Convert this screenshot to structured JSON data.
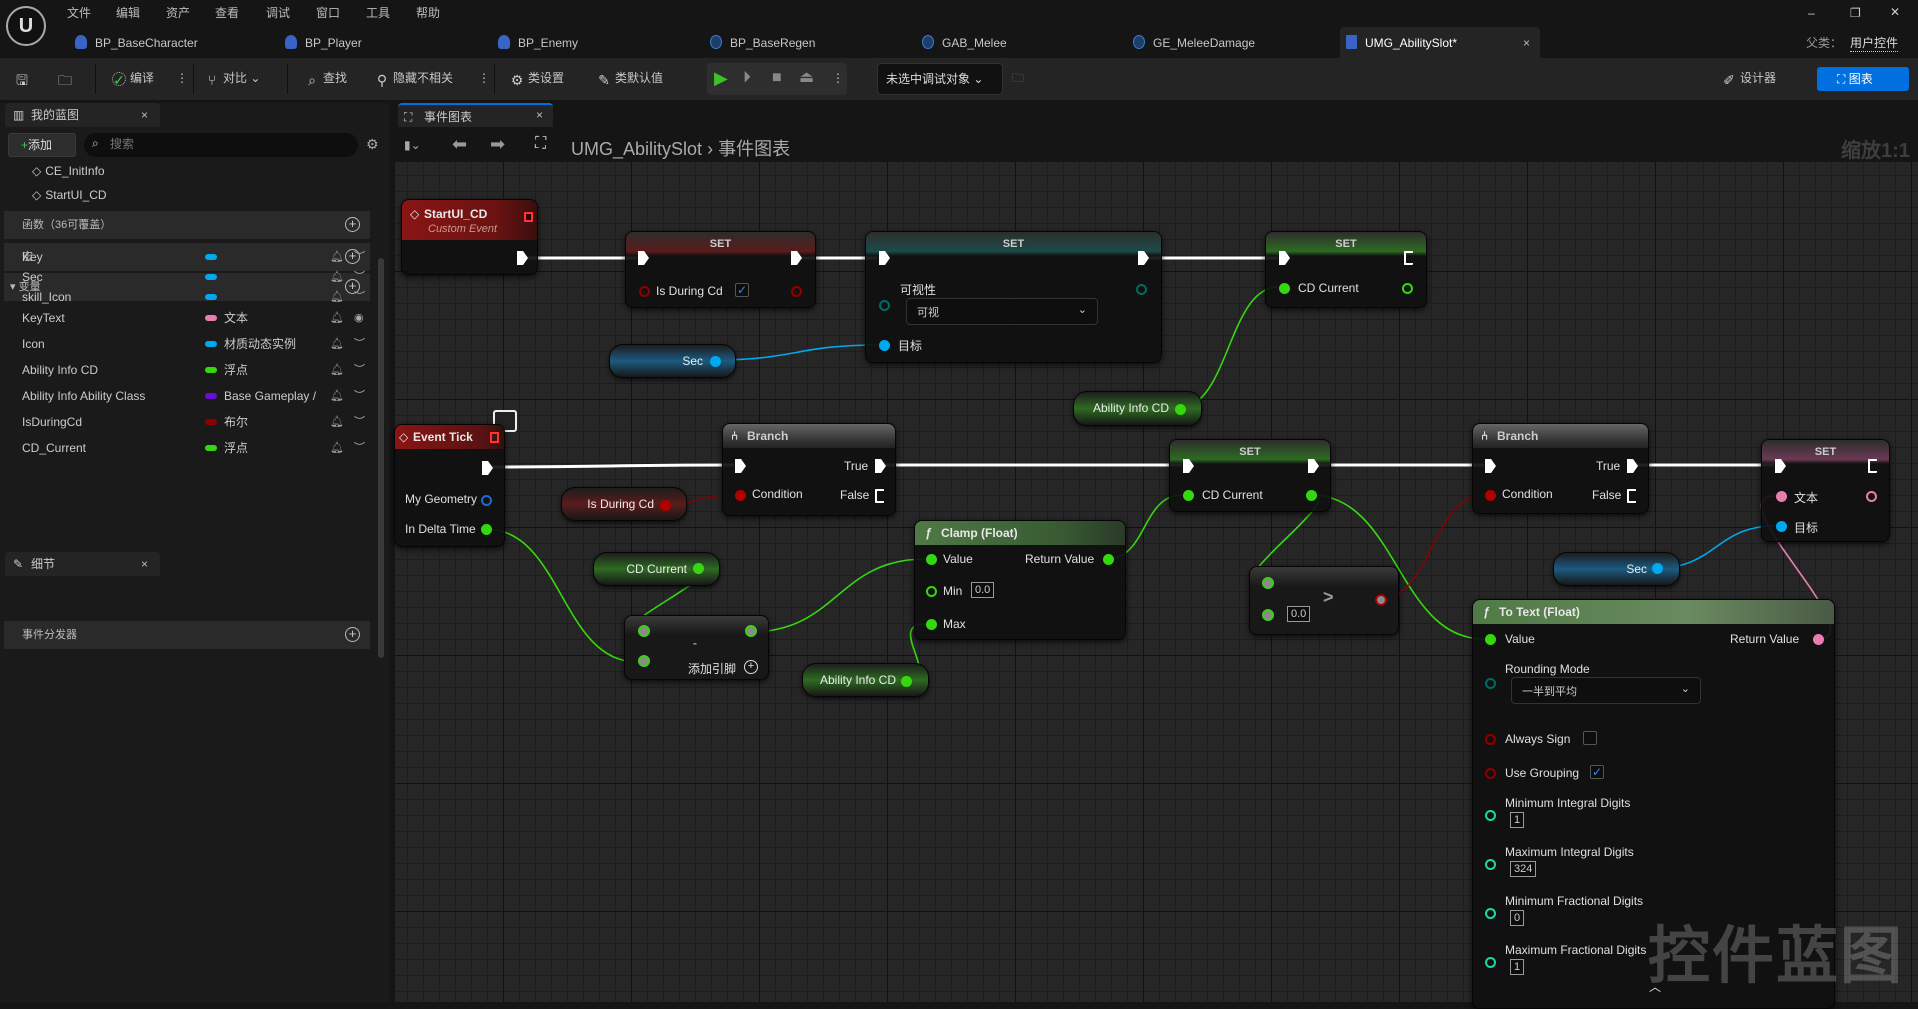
{
  "menu": [
    "文件",
    "编辑",
    "资产",
    "查看",
    "调试",
    "窗口",
    "工具",
    "帮助"
  ],
  "logo": "U",
  "tabs": [
    {
      "label": "BP_BaseCharacter"
    },
    {
      "label": "BP_Player"
    },
    {
      "label": "BP_Enemy"
    },
    {
      "label": "BP_BaseRegen"
    },
    {
      "label": "GAB_Melee"
    },
    {
      "label": "GE_MeleeDamage"
    },
    {
      "label": "UMG_AbilitySlot*"
    }
  ],
  "parent_class": {
    "label": "父类：",
    "value": "用户控件"
  },
  "window_controls": {
    "minimize": "–",
    "restore": "❐",
    "close": "✕"
  },
  "toolbar": {
    "compile": "编译",
    "diff": "对比",
    "find": "查找",
    "hide_unrelated": "隐藏不相关",
    "class_settings": "类设置",
    "class_defaults": "类默认值",
    "debug_target": "未选中调试对象",
    "designer": "设计器",
    "graph": "图表"
  },
  "left_panel": {
    "tab": "我的蓝图",
    "add": "添加",
    "search_placeholder": "搜索",
    "events": [
      "CE_InitInfo",
      "StartUI_CD"
    ],
    "sections": {
      "functions": "函数（36可覆盖）",
      "macros": "宏",
      "variables": "变量",
      "dispatchers": "事件分发器"
    },
    "variables": [
      {
        "name": "Key",
        "type": "",
        "color": "#00a8f0",
        "visible": false
      },
      {
        "name": "Sec",
        "type": "",
        "color": "#00a8f0",
        "visible": false
      },
      {
        "name": "skill_Icon",
        "type": "",
        "color": "#00a8f0",
        "visible": false
      },
      {
        "name": "KeyText",
        "type": "文本",
        "color": "#e67fb0",
        "visible": true
      },
      {
        "name": "Icon",
        "type": "材质动态实例",
        "color": "#00a8f0",
        "visible": false
      },
      {
        "name": "Ability Info CD",
        "type": "浮点",
        "color": "#35d80e",
        "visible": false
      },
      {
        "name": "Ability Info Ability Class",
        "type": "Base Gameplay /",
        "color": "#6a0dd8",
        "visible": false
      },
      {
        "name": "IsDuringCd",
        "type": "布尔",
        "color": "#8e0000",
        "visible": false
      },
      {
        "name": "CD_Current",
        "type": "浮点",
        "color": "#35d80e",
        "visible": false
      }
    ],
    "details_tab": "细节"
  },
  "graph": {
    "tab": "事件图表",
    "breadcrumb": [
      "UMG_AbilitySlot",
      "事件图表"
    ],
    "zoom": "缩放1:1",
    "watermark": "控件蓝图",
    "nodes": {
      "startui": {
        "title": "StartUI_CD",
        "subtitle": "Custom Event"
      },
      "set1": {
        "title": "SET",
        "pin": "Is During Cd",
        "checked": true
      },
      "set2": {
        "title": "SET",
        "prop": "可视性",
        "value": "可视",
        "target": "目标"
      },
      "set3": {
        "title": "SET",
        "pin": "CD Current"
      },
      "sec1": {
        "label": "Sec"
      },
      "aicd1": {
        "label": "Ability Info CD"
      },
      "tick": {
        "title": "Event Tick",
        "pin1": "My Geometry",
        "pin2": "In Delta Time"
      },
      "isdcd": {
        "label": "Is During Cd"
      },
      "branch1": {
        "title": "Branch",
        "true": "True",
        "cond": "Condition",
        "false": "False"
      },
      "cdcur": {
        "label": "CD Current"
      },
      "minus": {
        "op": "-",
        "add_pin": "添加引脚"
      },
      "clamp": {
        "title": "Clamp (Float)",
        "value": "Value",
        "ret": "Return Value",
        "min": "Min",
        "min_val": "0.0",
        "max": "Max"
      },
      "aicd2": {
        "label": "Ability Info CD"
      },
      "set4": {
        "title": "SET",
        "pin": "CD Current"
      },
      "greater": {
        "op": ">",
        "b_val": "0.0"
      },
      "branch2": {
        "title": "Branch",
        "true": "True",
        "cond": "Condition",
        "false": "False"
      },
      "set5": {
        "title": "SET",
        "pin1": "文本",
        "pin2": "目标"
      },
      "sec2": {
        "label": "Sec"
      },
      "totext": {
        "title": "To Text (Float)",
        "value": "Value",
        "ret": "Return Value",
        "rounding": "Rounding Mode",
        "rounding_val": "一半到平均",
        "always_sign": "Always Sign",
        "always_sign_checked": false,
        "use_grouping": "Use Grouping",
        "use_grouping_checked": true,
        "min_int": "Minimum Integral Digits",
        "min_int_val": "1",
        "max_int": "Maximum Integral Digits",
        "max_int_val": "324",
        "min_frac": "Minimum Fractional Digits",
        "min_frac_val": "0",
        "max_frac": "Maximum Fractional Digits",
        "max_frac_val": "1"
      }
    }
  },
  "colors": {
    "exec": "#ffffff",
    "float": "#35d80e",
    "bool": "#8e0000",
    "object": "#00a8f0",
    "text": "#e67fb0",
    "enum": "#006b63",
    "accent": "#0070e0"
  }
}
